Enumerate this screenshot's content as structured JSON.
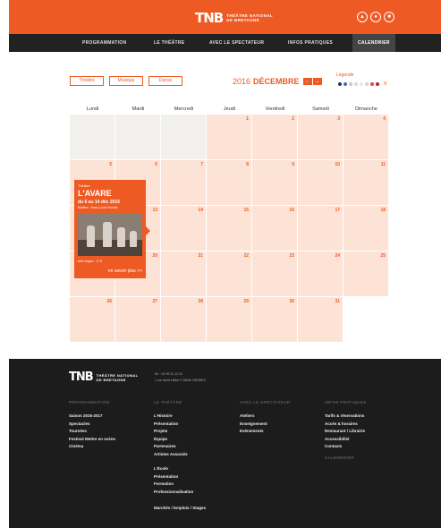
{
  "header": {
    "logo_mark": "TNB",
    "logo_line1": "THÉÂTRE NATIONAL",
    "logo_line2": "DE BRETAGNE",
    "icons": [
      "ticket-icon",
      "user-icon",
      "cart-icon"
    ]
  },
  "nav": {
    "items": [
      "PROGRAMMATION",
      "LE THÉÂTRE",
      "AVEC LE SPECTATEUR",
      "INFOS PRATIQUES",
      "CALENDRIER"
    ],
    "active_index": 4
  },
  "filters": [
    "Théâtre",
    "Musique",
    "Danse"
  ],
  "month_nav": {
    "year": "2016",
    "month": "DÉCEMBRE",
    "prev": "←",
    "next": "→"
  },
  "legend": {
    "label": "Légende",
    "colors": [
      "#2a2f5c",
      "#3a6fb0",
      "#c7c7c7",
      "#d9d9d9",
      "#e8e8e8",
      "#f0c8c8",
      "#e04a3a",
      "#c41a2a"
    ]
  },
  "calendar": {
    "days": [
      "Lundi",
      "Mardi",
      "Mercredi",
      "Jeudi",
      "Vendredi",
      "Samedi",
      "Dimanche"
    ],
    "weeks": [
      [
        "",
        "",
        "",
        "1",
        "2",
        "3",
        "4"
      ],
      [
        "5",
        "6",
        "7",
        "8",
        "9",
        "10",
        "11"
      ],
      [
        "12",
        "13",
        "14",
        "15",
        "16",
        "17",
        "18"
      ],
      [
        "19",
        "20",
        "21",
        "22",
        "23",
        "24",
        "25"
      ],
      [
        "26",
        "27",
        "28",
        "29",
        "30",
        "31",
        null
      ]
    ]
  },
  "event": {
    "category": "Théâtre",
    "title": "L'AVARE",
    "dates": "du 6 au 14 déc 2016",
    "author": "Molière / Jean-Louis Hourdin",
    "price": "tarif unique : 17 €",
    "more": "en savoir plus >>"
  },
  "footer": {
    "logo_line1": "THÉÂTRE NATIONAL",
    "logo_line2": "DE BRETAGNE",
    "phone": "tél. : 02 99 31 12 31",
    "address": "1 rue Saint-Hélier  F-35040 RENNES",
    "columns": [
      {
        "title": "PROGRAMMATION",
        "links": [
          "Saison 2016-2017",
          "Spectacles",
          "Tournées",
          "Festival Mettre en scène",
          "Cinéma"
        ]
      },
      {
        "title": "LE THÉÂTRE",
        "links": [
          "L'Histoire",
          "Présentation",
          "Projets",
          "Équipe",
          "Partenaires",
          "Artistes Associés"
        ]
      },
      {
        "title": "AVEC LE SPECTATEUR",
        "links": [
          "Ateliers",
          "Enseignement",
          "Evènements"
        ]
      },
      {
        "title": "INFOS PRATIQUES",
        "links": [
          "Tarifs & réservations",
          "Accès & horaires",
          "Restaurant / Librairie",
          "Accessibilité",
          "Contacts"
        ]
      }
    ],
    "ecole_links": [
      "L'École",
      "Présentation",
      "Formation",
      "Professionnalisation"
    ],
    "jobs_link": "Marchés / Emplois / Stages",
    "calendrier": "CALENDRIER"
  }
}
